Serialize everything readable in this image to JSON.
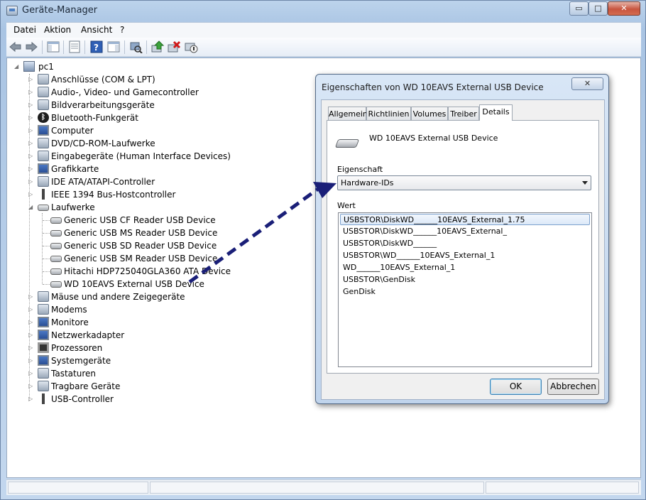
{
  "window": {
    "title": "Geräte-Manager",
    "min_label": "▭",
    "max_label": "□",
    "close_label": "✕"
  },
  "menu": {
    "items": [
      "Datei",
      "Aktion",
      "Ansicht",
      "?"
    ]
  },
  "toolbar": {
    "icons": [
      "back-arrow-icon",
      "forward-arrow-icon",
      "show-hide-console-tree-icon",
      "properties-icon",
      "help-icon",
      "action-pane-icon",
      "scan-hardware-icon",
      "update-driver-icon",
      "uninstall-icon",
      "disable-device-icon"
    ]
  },
  "tree": {
    "root": "pc1",
    "categories": [
      "Anschlüsse (COM & LPT)",
      "Audio-, Video- und Gamecontroller",
      "Bildverarbeitungsgeräte",
      "Bluetooth-Funkgerät",
      "Computer",
      "DVD/CD-ROM-Laufwerke",
      "Eingabegeräte (Human Interface Devices)",
      "Grafikkarte",
      "IDE ATA/ATAPI-Controller",
      "IEEE 1394 Bus-Hostcontroller",
      "Laufwerke"
    ],
    "drives": [
      "Generic USB CF Reader USB Device",
      "Generic USB MS Reader USB Device",
      "Generic USB SD Reader USB Device",
      "Generic USB SM Reader USB Device",
      "Hitachi HDP725040GLA360 ATA Device",
      "WD 10EAVS External USB Device"
    ],
    "categories_after": [
      "Mäuse und andere Zeigegeräte",
      "Modems",
      "Monitore",
      "Netzwerkadapter",
      "Prozessoren",
      "Systemgeräte",
      "Tastaturen",
      "Tragbare Geräte",
      "USB-Controller"
    ]
  },
  "dialog": {
    "title": "Eigenschaften von WD 10EAVS External USB Device",
    "close_label": "✕",
    "tabs": [
      "Allgemein",
      "Richtlinien",
      "Volumes",
      "Treiber",
      "Details"
    ],
    "active_tab": "Details",
    "device_name": "WD 10EAVS External USB Device",
    "property_label": "Eigenschaft",
    "property_value": "Hardware-IDs",
    "value_label": "Wert",
    "values": [
      "USBSTOR\\DiskWD______10EAVS_External_1.75",
      "USBSTOR\\DiskWD______10EAVS_External_",
      "USBSTOR\\DiskWD______",
      "USBSTOR\\WD______10EAVS_External_1",
      "WD______10EAVS_External_1",
      "USBSTOR\\GenDisk",
      "GenDisk"
    ],
    "ok_label": "OK",
    "cancel_label": "Abbrechen"
  },
  "colors": {
    "annotation_arrow": "#1a1f78",
    "title_gradient": "#bcd3ec",
    "selection": "#dce9f8"
  }
}
